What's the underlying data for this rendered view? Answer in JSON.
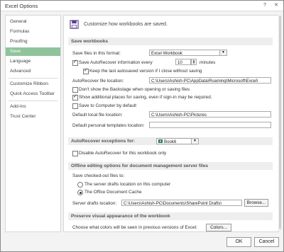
{
  "window": {
    "title": "Excel Options",
    "help_glyph": "?",
    "close_glyph": "✕"
  },
  "sidebar": {
    "items": [
      {
        "label": "General"
      },
      {
        "label": "Formulas"
      },
      {
        "label": "Proofing"
      },
      {
        "label": "Save"
      },
      {
        "label": "Language"
      },
      {
        "label": "Advanced"
      },
      {
        "label": "Customize Ribbon"
      },
      {
        "label": "Quick Access Toolbar"
      },
      {
        "label": "Add-Ins"
      },
      {
        "label": "Trust Center"
      }
    ],
    "selected": "Save"
  },
  "main": {
    "header": "Customize how workbooks are saved.",
    "save_workbooks": {
      "section": "Save workbooks",
      "format_label": "Save files in this format:",
      "format_value": "Excel Workbook",
      "autorecover_label": "Save AutoRecover information every",
      "autorecover_checked": true,
      "autorecover_minutes": "10",
      "minutes_label": "minutes",
      "keep_last_label": "Keep the last autosaved version if I close without saving",
      "keep_last_checked": true,
      "autorecover_location_label": "AutoRecover file location:",
      "autorecover_location_value": "C:\\Users\\Ashish-PC\\AppData\\Roaming\\Microsoft\\Excel\\",
      "dont_show_backstage_label": "Don't show the Backstage when opening or saving files",
      "dont_show_backstage_checked": false,
      "show_additional_label": "Show additional places for saving, even if sign-in may be required.",
      "show_additional_checked": true,
      "save_to_computer_label": "Save to Computer by default",
      "save_to_computer_checked": false,
      "default_local_label": "Default local file location:",
      "default_local_value": "C:\\Users\\Ashish-PC\\Pictures",
      "default_templates_label": "Default personal templates location:",
      "default_templates_value": ""
    },
    "autorecover_exceptions": {
      "section_label": "AutoRecover exceptions for:",
      "workbook_value": "Book6",
      "disable_label": "Disable AutoRecover for this workbook only",
      "disable_checked": false
    },
    "offline_editing": {
      "section": "Offline editing options for document management server files",
      "checked_out_label": "Save checked-out files to:",
      "option_server": "The server drafts location on this computer",
      "option_cache": "The Office Document Cache",
      "selected": "cache",
      "server_drafts_label": "Server drafts location:",
      "server_drafts_value": "C:\\Users\\Ashish-PC\\Documents\\SharePoint Drafts\\",
      "browse_label": "Browse..."
    },
    "preserve": {
      "section": "Preserve visual appearance of the workbook",
      "colors_question": "Choose what colors will be seen in previous versions of Excel:",
      "colors_button": "Colors..."
    }
  },
  "footer": {
    "ok": "OK",
    "cancel": "Cancel"
  },
  "colors": {
    "selected_sidebar": "#8fc39b",
    "excel_green": "#217346"
  }
}
